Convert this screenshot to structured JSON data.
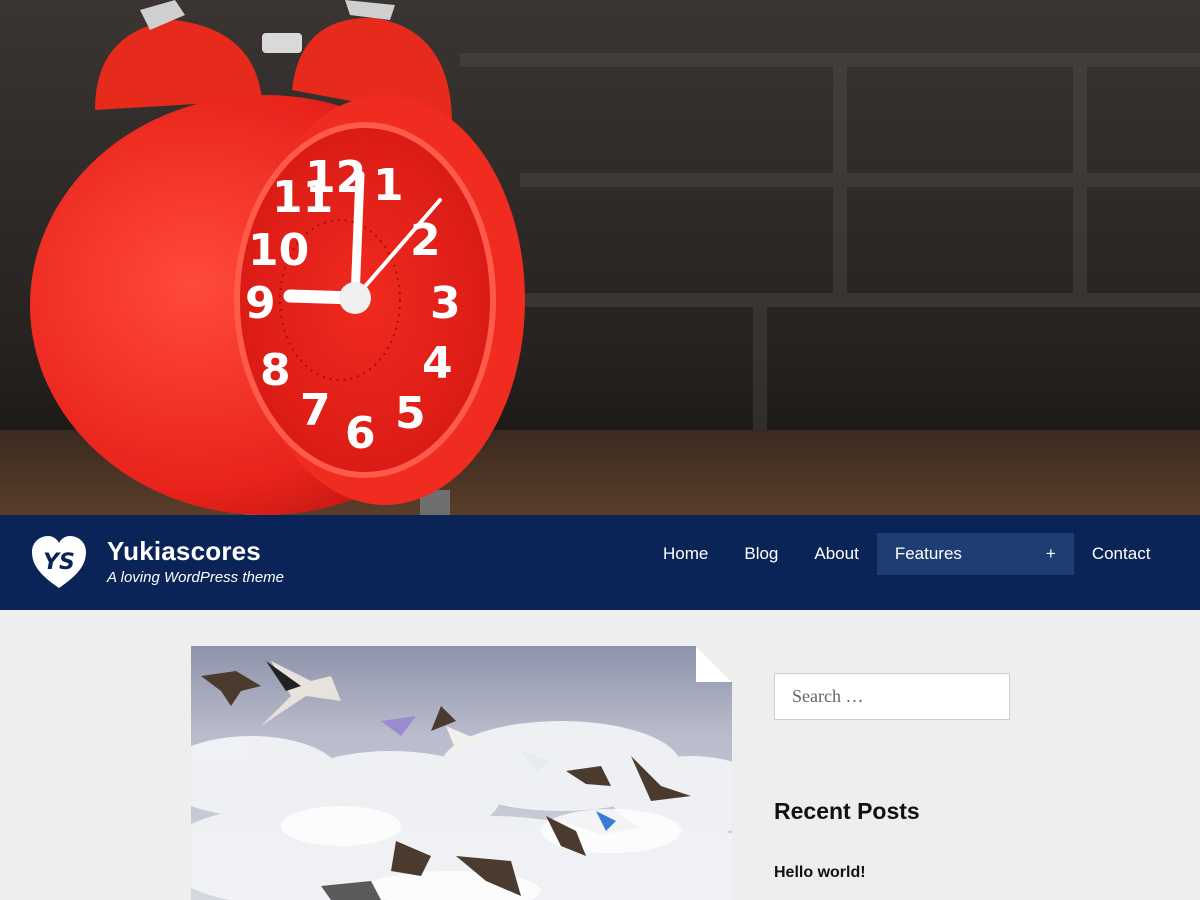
{
  "site": {
    "title": "Yukiascores",
    "tagline": "A loving WordPress theme",
    "logo_icon": "heart-ys-logo-icon",
    "brand_color": "#0b2457",
    "active_nav_color": "#1e3d73",
    "logo_monogram": "YS"
  },
  "nav": {
    "home": "Home",
    "blog": "Blog",
    "about": "About",
    "features": "Features",
    "features_expand": "+",
    "contact": "Contact"
  },
  "hero": {
    "image": "red-alarm-clock-photo"
  },
  "post": {
    "image": "birds-flying-over-clouds-photo"
  },
  "sidebar": {
    "search_placeholder": "Search …",
    "recent_posts_title": "Recent Posts",
    "recent_posts": [
      "Hello world!"
    ]
  }
}
